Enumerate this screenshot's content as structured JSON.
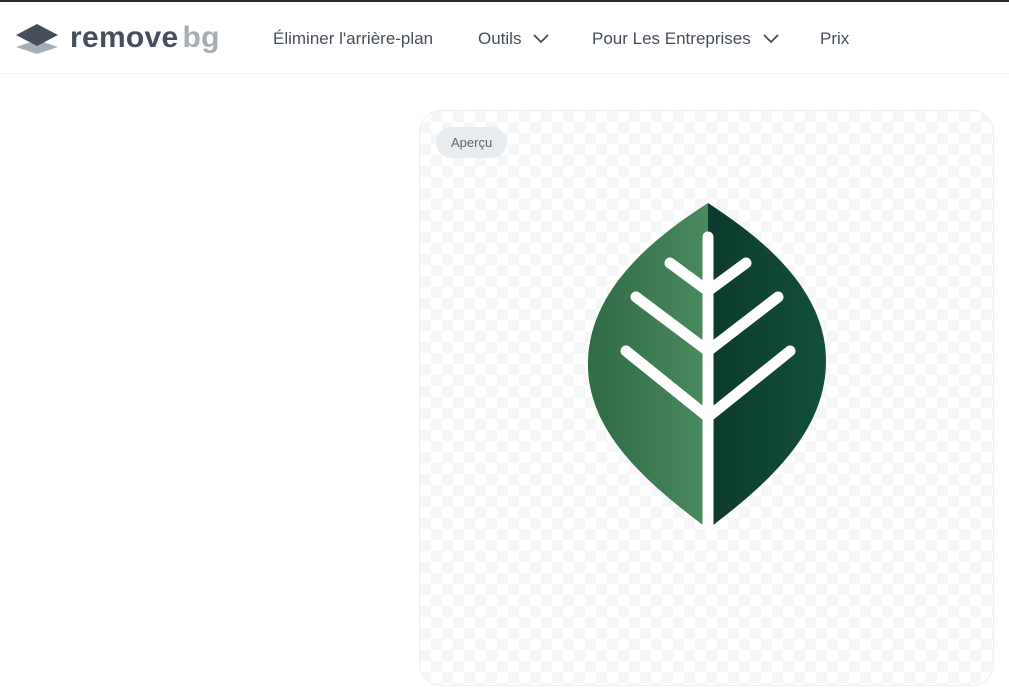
{
  "header": {
    "logo": {
      "word_primary": "remove",
      "word_secondary": "bg",
      "icon": "layers-logo-icon"
    },
    "nav": {
      "remove_bg": "Éliminer l'arrière-plan",
      "tools": "Outils",
      "business": "Pour Les Entreprises",
      "pricing": "Prix"
    }
  },
  "preview": {
    "badge": "Aperçu",
    "image": "leaf-image",
    "background": "transparency-checkerboard"
  },
  "colors": {
    "text": "#454f5b",
    "logo_muted": "#a7adb4",
    "leaf_light": "#3f7d55",
    "leaf_dark": "#0f4433",
    "badge_bg": "#e9ecef"
  }
}
